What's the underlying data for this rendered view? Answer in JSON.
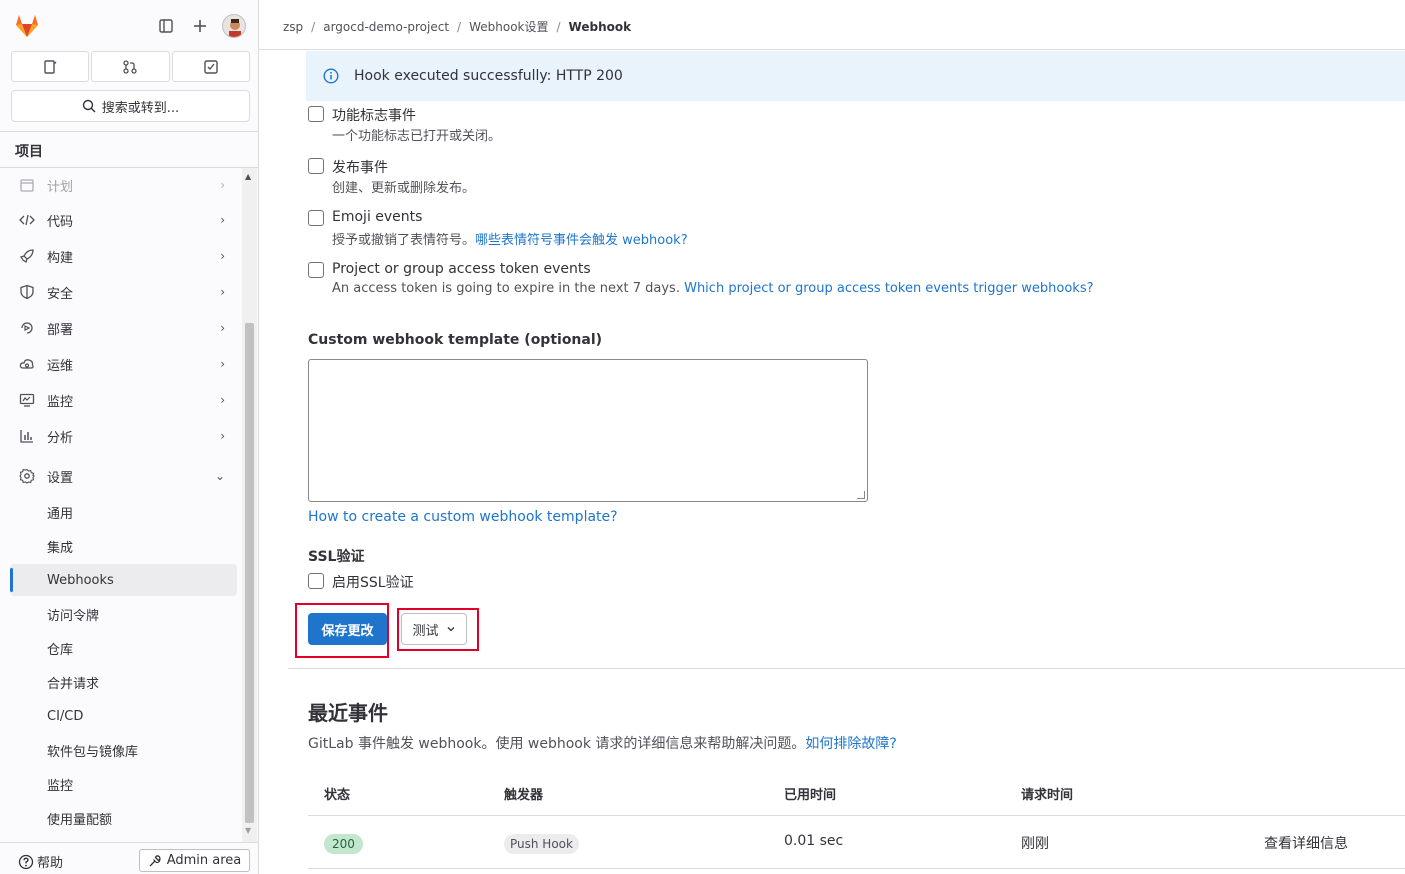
{
  "sidebar": {
    "search_label": "搜索或转到...",
    "section_title": "项目",
    "nav_items": [
      {
        "label": "计划",
        "icon": "calendar-icon"
      },
      {
        "label": "代码",
        "icon": "code-icon"
      },
      {
        "label": "构建",
        "icon": "rocket-icon"
      },
      {
        "label": "安全",
        "icon": "shield-icon"
      },
      {
        "label": "部署",
        "icon": "deploy-icon"
      },
      {
        "label": "运维",
        "icon": "cloud-gear-icon"
      },
      {
        "label": "监控",
        "icon": "monitor-icon"
      },
      {
        "label": "分析",
        "icon": "chart-icon"
      },
      {
        "label": "设置",
        "icon": "gear-icon"
      }
    ],
    "settings_subitems": [
      "通用",
      "集成",
      "Webhooks",
      "访问令牌",
      "仓库",
      "合并请求",
      "CI/CD",
      "软件包与镜像库",
      "监控",
      "使用量配额"
    ],
    "help_label": "帮助",
    "admin_label": "Admin area"
  },
  "breadcrumb": [
    "zsp",
    "argocd-demo-project",
    "Webhook设置",
    "Webhook"
  ],
  "alert": {
    "text": "Hook executed successfully: HTTP 200"
  },
  "events": [
    {
      "label": "功能标志事件",
      "help": "一个功能标志已打开或关闭。",
      "link": ""
    },
    {
      "label": "发布事件",
      "help": "创建、更新或删除发布。",
      "link": ""
    },
    {
      "label": "Emoji events",
      "help": "授予或撤销了表情符号。",
      "link": "哪些表情符号事件会触发 webhook?"
    },
    {
      "label": "Project or group access token events",
      "help": "An access token is going to expire in the next 7 days. ",
      "link": "Which project or group access token events trigger webhooks?"
    }
  ],
  "template": {
    "label": "Custom webhook template (optional)",
    "help_link": "How to create a custom webhook template?"
  },
  "ssl": {
    "title": "SSL验证",
    "checkbox_label": "启用SSL验证"
  },
  "actions": {
    "save_label": "保存更改",
    "test_label": "测试"
  },
  "recent_events": {
    "title": "最近事件",
    "description": "GitLab 事件触发 webhook。使用 webhook 请求的详细信息来帮助解决问题。",
    "troubleshoot_link": "如何排除故障?",
    "columns": [
      "状态",
      "触发器",
      "已用时间",
      "请求时间"
    ],
    "rows": [
      {
        "status": "200",
        "trigger": "Push Hook",
        "elapsed": "0.01 sec",
        "request_time": "刚刚",
        "details": "查看详细信息"
      }
    ]
  },
  "colors": {
    "accent": "#1f75cb",
    "alert_bg": "#e9f3fc",
    "success_badge": "#c3e6cd",
    "highlight": "#e0002a"
  }
}
